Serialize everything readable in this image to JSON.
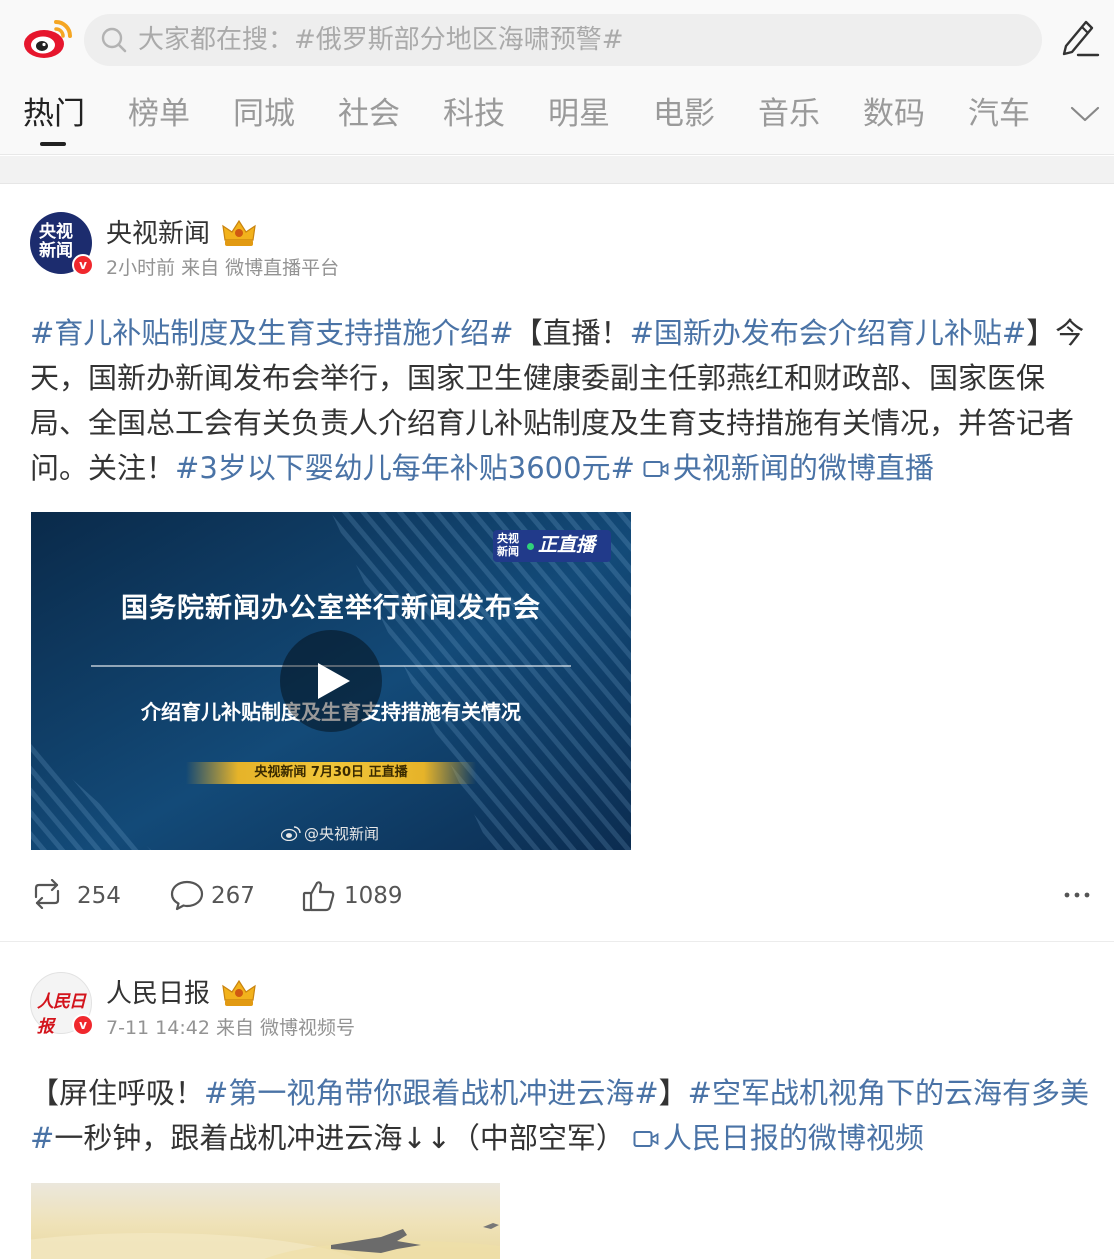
{
  "search": {
    "placeholder": "大家都在搜：#俄罗斯部分地区海啸预警#"
  },
  "tabs": [
    {
      "label": "热门",
      "active": true
    },
    {
      "label": "榜单"
    },
    {
      "label": "同城"
    },
    {
      "label": "社会"
    },
    {
      "label": "科技"
    },
    {
      "label": "明星"
    },
    {
      "label": "电影"
    },
    {
      "label": "音乐"
    },
    {
      "label": "数码"
    },
    {
      "label": "汽车"
    }
  ],
  "colors": {
    "accent_link": "#4a73a6",
    "verified_badge": "#f0282d",
    "tab_active": "#222222",
    "tab_inactive": "#9a9a9a"
  },
  "posts": [
    {
      "avatar_text": [
        "央视",
        "新闻"
      ],
      "username": "央视新闻",
      "meta": "2小时前 来自 微博直播平台",
      "content": {
        "tag1": "#育儿补贴制度及生育支持措施介绍#",
        "text1": "【直播！",
        "tag2": "#国新办发布会介绍育儿补贴#",
        "text2": "】今天，国新办新闻发布会举行，国家卫生健康委副主任郭燕红和财政部、国家医保局、全国总工会有关负责人介绍育儿补贴制度及生育支持措施有关情况，并答记者问。关注！",
        "tag3": "#3岁以下婴幼儿每年补贴3600元#",
        "link": "央视新闻的微博直播"
      },
      "video": {
        "live_source": [
          "央视",
          "新闻"
        ],
        "live_label": "正直播",
        "title": "国务院新闻办公室举行新闻发布会",
        "subtitle": "介绍育儿补贴制度及生育支持措施有关情况",
        "ribbon": "央视新闻 7月30日 正直播",
        "watermark": "@央视新闻"
      },
      "reposts": "254",
      "comments": "267",
      "likes": "1089"
    },
    {
      "avatar_text": "人民日报",
      "username": "人民日报",
      "meta": "7-11 14:42 来自 微博视频号",
      "content": {
        "text1": "【屏住呼吸！",
        "tag1": "#第一视角带你跟着战机冲进云海#",
        "text2": "】",
        "tag2": "#空军战机视角下的云海有多美#",
        "text3": "一秒钟，跟着战机冲进云海↓↓（中部空军）",
        "link": "人民日报的微博视频"
      }
    }
  ]
}
